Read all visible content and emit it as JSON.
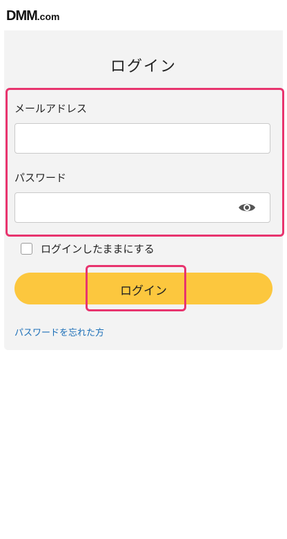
{
  "header": {
    "logo_main": "DMM",
    "logo_suffix": ".com"
  },
  "page": {
    "title": "ログイン"
  },
  "form": {
    "email_label": "メールアドレス",
    "email_value": "",
    "password_label": "パスワード",
    "password_value": "",
    "password_toggle_icon": "eye-icon",
    "remember_label": "ログインしたままにする",
    "remember_checked": false,
    "submit_label": "ログイン",
    "forgot_link": "パスワードを忘れた方"
  },
  "colors": {
    "accent_button": "#fcc73e",
    "highlight": "#e8346e",
    "link": "#1c6fb8",
    "card_bg": "#f3f3f3"
  }
}
